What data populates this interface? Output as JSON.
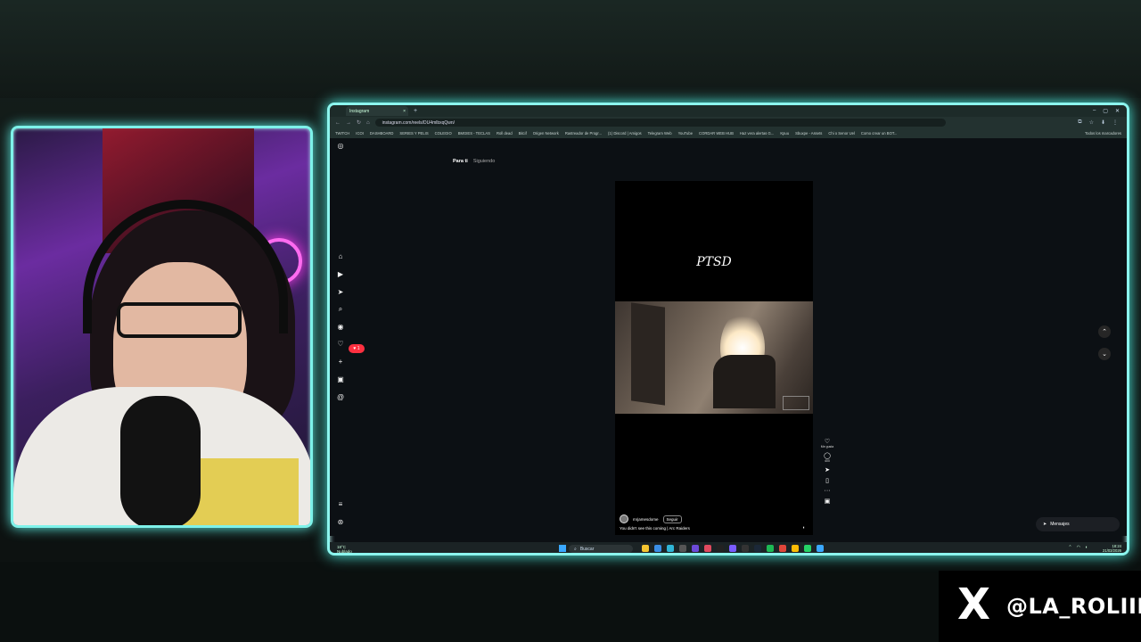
{
  "browser": {
    "tab_title": "Instagram",
    "tab_close": "×",
    "new_tab": "+",
    "url": "instagram.com/reels/DU4mlbxqQwn/",
    "window_buttons": [
      "–",
      "▢",
      "✕"
    ],
    "nav": [
      "←",
      "→",
      "↻",
      "⌂"
    ],
    "url_icons": [
      "⧉",
      "☆",
      "⬇",
      "⋮"
    ],
    "bookmarks": [
      "TWITCH",
      "ICOI",
      "DASHBOARD",
      "SERIES Y PELIS",
      "COLEGIO",
      "BMGIES - TECLAS",
      "Roll dead",
      "Bitcif",
      "Origen Network",
      "Rastreador de Progr...",
      "(1) Discord | Amigos",
      "Telegram Web",
      "YouTube",
      "CORDAR WEB HUB",
      "Haz vera alertas G...",
      "Kpuu",
      "Sbuxpe - Assets",
      "Chi o Senor Uel",
      "Como crear un BOT..."
    ],
    "all_bookmarks": "Todos los marcadores"
  },
  "instagram": {
    "side_icons": [
      "instagram-logo",
      "home",
      "reels",
      "send",
      "search",
      "explore",
      "heart",
      "create",
      "profile-box",
      "threads",
      "menu",
      "threads-app"
    ],
    "notification_count": "1",
    "feed_tabs": {
      "active": "Para ti",
      "inactive": "Siguiendo"
    },
    "reel": {
      "title": "PTSD",
      "username": "mrjamesdome",
      "follow_label": "Seguir",
      "caption": "You didn't see this coming | Arc Raiders"
    },
    "actions": {
      "like_label": "Me gusta",
      "comments_count": "400"
    },
    "messages_label": "Mensajes"
  },
  "taskbar": {
    "weather_temp": "18°C",
    "weather_desc": "Nublado",
    "search_placeholder": "Buscar",
    "time": "18:24",
    "date": "21/03/2026"
  },
  "overlay": {
    "handle": "@LA_ROLIII",
    "x_logo": "X"
  },
  "colors": {
    "frame_glow": "#8cf5ee",
    "ig_background": "#0c1014",
    "notification_red": "#ff3040"
  }
}
